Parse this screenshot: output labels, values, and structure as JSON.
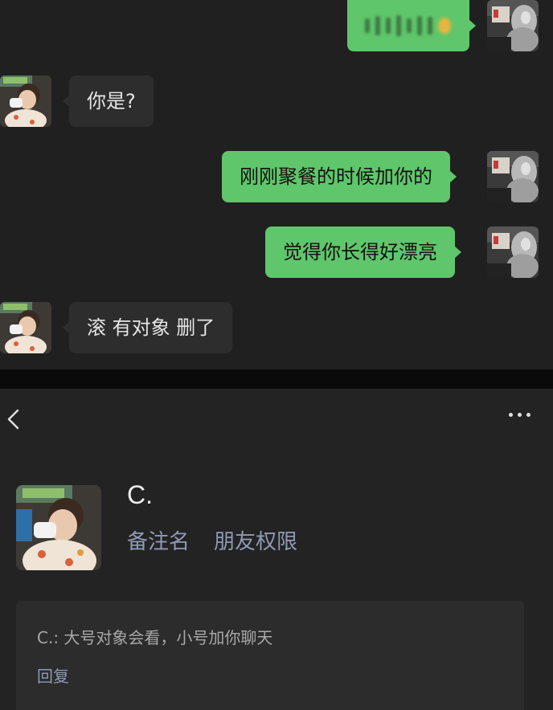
{
  "chat": {
    "messages": [
      {
        "direction": "out",
        "text": "",
        "redacted": true
      },
      {
        "direction": "in",
        "text": "你是?"
      },
      {
        "direction": "out",
        "text": "刚刚聚餐的时候加你的"
      },
      {
        "direction": "out",
        "text": "觉得你长得好漂亮"
      },
      {
        "direction": "in",
        "text": "滚 有对象 删了"
      }
    ]
  },
  "profile": {
    "back_icon": "chevron-left-icon",
    "more_icon": "more-dots-icon",
    "name": "C.",
    "remark_label": "备注名",
    "permission_label": "朋友权限",
    "comment": {
      "text": "C.: 大号对象会看，小号加你聊天",
      "reply_label": "回复"
    }
  },
  "colors": {
    "outgoing_bubble": "#5FC66B",
    "incoming_bubble": "#2D2D2D",
    "link_color": "#8E9AB5",
    "chat_background": "#202020",
    "profile_background": "#232323"
  }
}
